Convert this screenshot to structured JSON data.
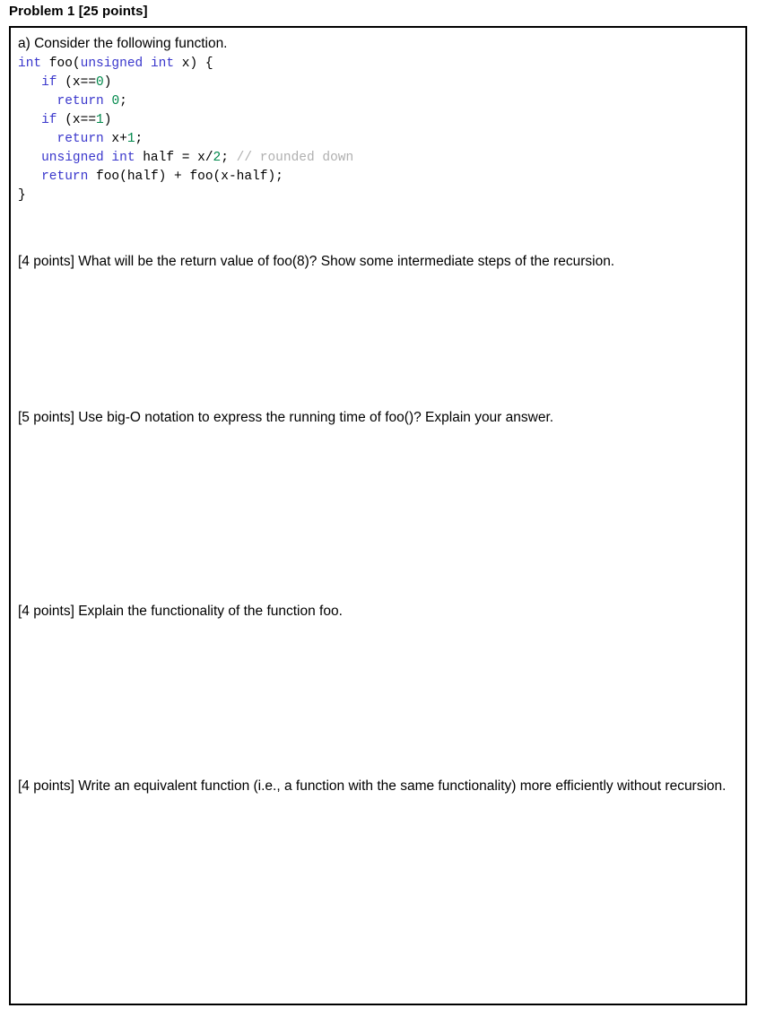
{
  "document": {
    "problem_title": "Problem 1 [25 points]",
    "intro": "a) Consider the following function."
  },
  "code": {
    "language": "c",
    "colors": {
      "keyword": "#3a37cc",
      "number": "#00884b",
      "comment": "#b0b0b0",
      "plain": "#000000"
    },
    "lines": [
      "int foo(unsigned int x) {",
      "   if (x==0)",
      "     return 0;",
      "   if (x==1)",
      "     return x+1;",
      "   unsigned int half = x/2; // rounded down",
      "   return foo(half) + foo(x-half);",
      "}"
    ],
    "tokens": [
      [
        {
          "t": "int",
          "c": "kw"
        },
        {
          "t": " foo(",
          "c": "pln"
        },
        {
          "t": "unsigned int",
          "c": "kw"
        },
        {
          "t": " x) {",
          "c": "pln"
        }
      ],
      [
        {
          "t": "   ",
          "c": "pln"
        },
        {
          "t": "if",
          "c": "kw"
        },
        {
          "t": " (x==",
          "c": "pln"
        },
        {
          "t": "0",
          "c": "num"
        },
        {
          "t": ")",
          "c": "pln"
        }
      ],
      [
        {
          "t": "     ",
          "c": "pln"
        },
        {
          "t": "return",
          "c": "kw"
        },
        {
          "t": " ",
          "c": "pln"
        },
        {
          "t": "0",
          "c": "num"
        },
        {
          "t": ";",
          "c": "pln"
        }
      ],
      [
        {
          "t": "   ",
          "c": "pln"
        },
        {
          "t": "if",
          "c": "kw"
        },
        {
          "t": " (x==",
          "c": "pln"
        },
        {
          "t": "1",
          "c": "num"
        },
        {
          "t": ")",
          "c": "pln"
        }
      ],
      [
        {
          "t": "     ",
          "c": "pln"
        },
        {
          "t": "return",
          "c": "kw"
        },
        {
          "t": " x+",
          "c": "pln"
        },
        {
          "t": "1",
          "c": "num"
        },
        {
          "t": ";",
          "c": "pln"
        }
      ],
      [
        {
          "t": "   ",
          "c": "pln"
        },
        {
          "t": "unsigned int",
          "c": "kw"
        },
        {
          "t": " half = x/",
          "c": "pln"
        },
        {
          "t": "2",
          "c": "num"
        },
        {
          "t": "; ",
          "c": "pln"
        },
        {
          "t": "// rounded down",
          "c": "cmt"
        }
      ],
      [
        {
          "t": "   ",
          "c": "pln"
        },
        {
          "t": "return",
          "c": "kw"
        },
        {
          "t": " foo(half) + foo(x-half);",
          "c": "pln"
        }
      ],
      [
        {
          "t": "}",
          "c": "pln"
        }
      ]
    ]
  },
  "questions": [
    {
      "points_label": "[4 points]",
      "text": "[4 points] What will be the return value of foo(8)? Show some intermediate steps of the recursion."
    },
    {
      "points_label": "[5 points]",
      "text": "[5 points] Use big-O notation to express the running time of foo()? Explain your answer."
    },
    {
      "points_label": "[4 points]",
      "text": "[4 points] Explain the functionality of the function foo."
    },
    {
      "points_label": "[4 points]",
      "text": "[4 points] Write an equivalent function (i.e., a function with the same functionality) more efficiently without recursion."
    }
  ]
}
